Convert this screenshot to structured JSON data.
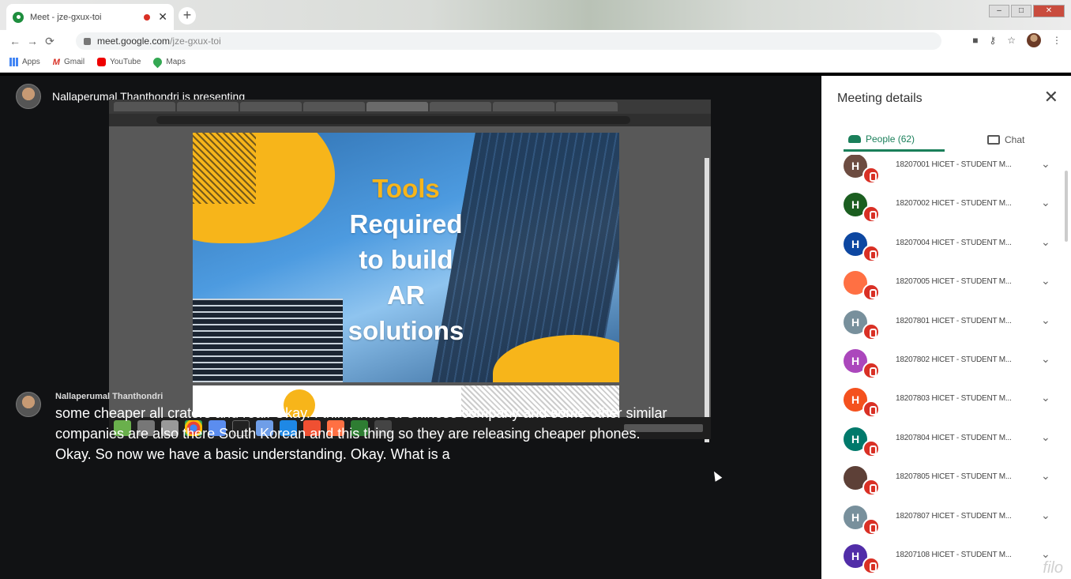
{
  "browser": {
    "tab_title": "Meet - jze-gxux-toi",
    "url_host": "meet.google.com",
    "url_path": "/jze-gxux-toi",
    "bookmarks": [
      "Apps",
      "Gmail",
      "YouTube",
      "Maps"
    ]
  },
  "meet": {
    "presenting_text": "Nallaperumal Thanthondri is presenting",
    "slide": {
      "line1": "Tools",
      "line2": "Required",
      "line3": "to build",
      "line4": "AR",
      "line5": "solutions"
    },
    "caption": {
      "speaker": "Nallaperumal Thanthondri",
      "text": "some cheaper all craters and real. Okay. I think that's a Chinese company and some other similar companies are also there South Korean and this thing so they are releasing cheaper phones. Okay. So now we have a basic understanding. Okay. What is a"
    }
  },
  "panel": {
    "title": "Meeting details",
    "tab_people": "People (62)",
    "tab_chat": "Chat",
    "participants": [
      {
        "initial": "H",
        "name": "18207001 HICET - STUDENT M...",
        "color": "#6d4c41"
      },
      {
        "initial": "H",
        "name": "18207002 HICET - STUDENT M...",
        "color": "#1b5e20"
      },
      {
        "initial": "H",
        "name": "18207004 HICET - STUDENT M...",
        "color": "#0d47a1"
      },
      {
        "initial": "",
        "name": "18207005 HICET - STUDENT M...",
        "color": "#ff7043"
      },
      {
        "initial": "H",
        "name": "18207801 HICET - STUDENT M...",
        "color": "#78909c"
      },
      {
        "initial": "H",
        "name": "18207802 HICET - STUDENT M...",
        "color": "#ab47bc"
      },
      {
        "initial": "H",
        "name": "18207803 HICET - STUDENT M...",
        "color": "#f4511e"
      },
      {
        "initial": "H",
        "name": "18207804 HICET - STUDENT M...",
        "color": "#00796b"
      },
      {
        "initial": "",
        "name": "18207805 HICET - STUDENT M...",
        "color": "#5d4037"
      },
      {
        "initial": "H",
        "name": "18207807 HICET - STUDENT M...",
        "color": "#78909c"
      },
      {
        "initial": "H",
        "name": "18207108 HICET - STUDENT M...",
        "color": "#512da8"
      }
    ]
  }
}
